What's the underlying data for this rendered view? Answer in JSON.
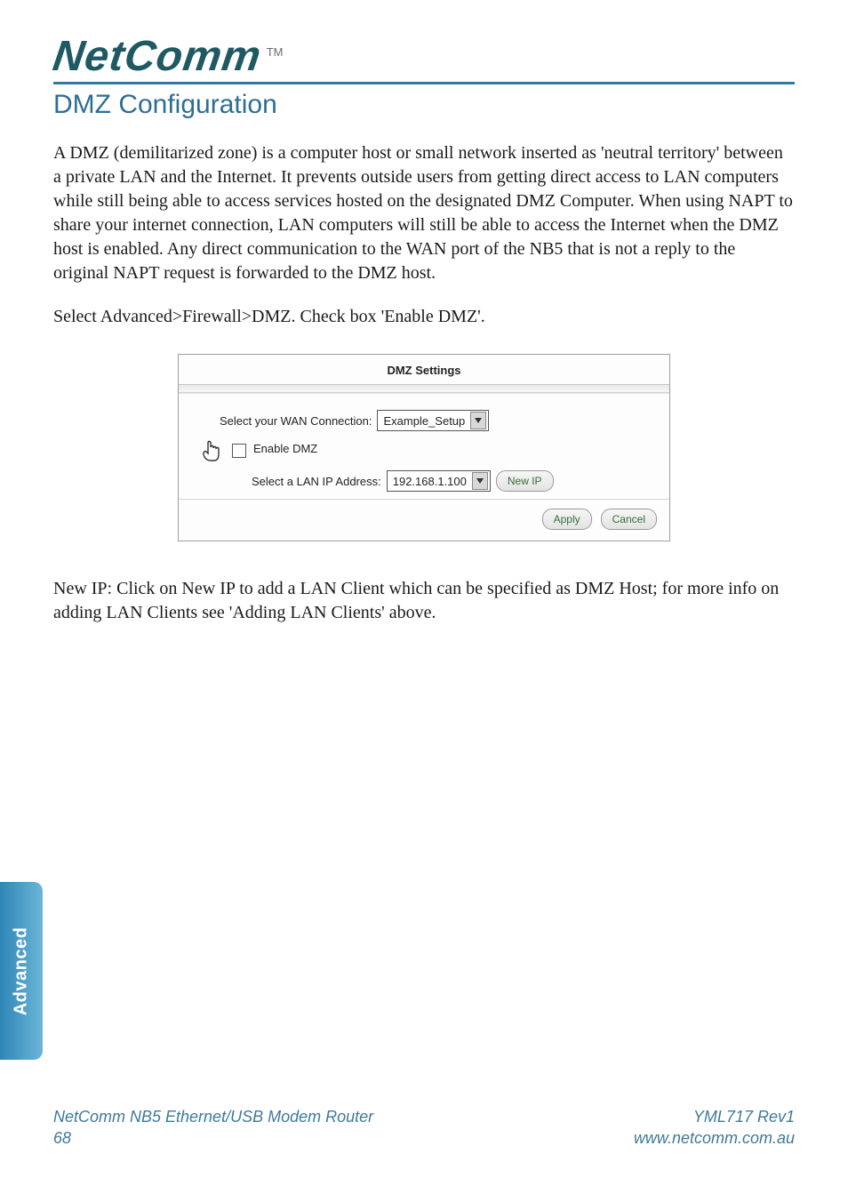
{
  "brand": {
    "name": "NetComm",
    "tm": "TM"
  },
  "section_title": "DMZ Configuration",
  "paragraphs": {
    "p1": "A DMZ (demilitarized zone) is a computer host or small network inserted as 'neutral territory' between a private LAN and the Internet. It prevents outside users from getting direct access to LAN computers while still being able to access services hosted on the designated DMZ Computer. When using NAPT to share your internet connection, LAN computers will still be able to access the Internet when the DMZ host is enabled. Any direct communication to the WAN port of the NB5 that is not a reply to the original NAPT request is forwarded to the DMZ host.",
    "p2": "Select Advanced>Firewall>DMZ.  Check box 'Enable DMZ'.",
    "p3": "New IP: Click on New IP to add a LAN Client which can be specified as DMZ Host; for more info on adding LAN Clients  see 'Adding LAN Clients' above."
  },
  "panel": {
    "title": "DMZ Settings",
    "wan_label": "Select your WAN Connection:",
    "wan_value": "Example_Setup",
    "enable_label": "Enable DMZ",
    "lan_label": "Select a LAN IP Address:",
    "lan_value": "192.168.1.100",
    "new_ip": "New IP",
    "apply": "Apply",
    "cancel": "Cancel"
  },
  "side_tab": "Advanced",
  "footer": {
    "left_line1": "NetComm NB5 Ethernet/USB Modem Router",
    "left_line2": "68",
    "right_line1": "YML717 Rev1",
    "right_line2": "www.netcomm.com.au"
  }
}
